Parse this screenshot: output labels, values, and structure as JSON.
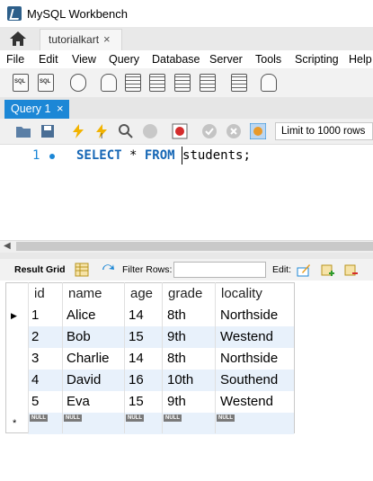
{
  "window": {
    "title": "MySQL Workbench"
  },
  "connection_tab": {
    "label": "tutorialkart",
    "close": "×"
  },
  "menu": [
    "File",
    "Edit",
    "View",
    "Query",
    "Database",
    "Server",
    "Tools",
    "Scripting",
    "Help"
  ],
  "query_tab": {
    "label": "Query 1",
    "close": "×"
  },
  "editor_toolbar": {
    "limit": "Limit to 1000 rows"
  },
  "editor": {
    "line_number": "1",
    "kw1": "SELECT",
    "star": " * ",
    "kw2": "FROM",
    "rest": " students;"
  },
  "result_toolbar": {
    "result_grid": "Result Grid",
    "filter_rows": "Filter Rows:",
    "filter_value": "",
    "edit": "Edit:"
  },
  "grid": {
    "columns": [
      "id",
      "name",
      "age",
      "grade",
      "locality"
    ],
    "rows": [
      [
        "1",
        "Alice",
        "14",
        "8th",
        "Northside"
      ],
      [
        "2",
        "Bob",
        "15",
        "9th",
        "Westend"
      ],
      [
        "3",
        "Charlie",
        "14",
        "8th",
        "Northside"
      ],
      [
        "4",
        "David",
        "16",
        "10th",
        "Southend"
      ],
      [
        "5",
        "Eva",
        "15",
        "9th",
        "Westend"
      ]
    ],
    "null_label": "NULL",
    "current_row_marker": "▶",
    "new_row_marker": "*"
  },
  "colors": {
    "accent": "#1c87d6",
    "keyword": "#1566b5",
    "row_alt": "#e8f1fb"
  },
  "icons": [
    "home-icon",
    "new-sql-tab-icon",
    "open-sql-file-icon",
    "info-icon",
    "new-schema-icon",
    "new-table-icon",
    "new-view-icon",
    "new-procedure-icon",
    "new-function-icon",
    "search-table-icon",
    "reconnect-icon",
    "open-file-icon",
    "save-icon",
    "execute-icon",
    "execute-current-icon",
    "explain-icon",
    "stop-icon",
    "toggle-error-icon",
    "commit-icon",
    "rollback-icon",
    "autocommit-icon",
    "result-grid-icon",
    "refresh-icon",
    "edit-row-icon",
    "add-row-icon",
    "delete-row-icon"
  ]
}
